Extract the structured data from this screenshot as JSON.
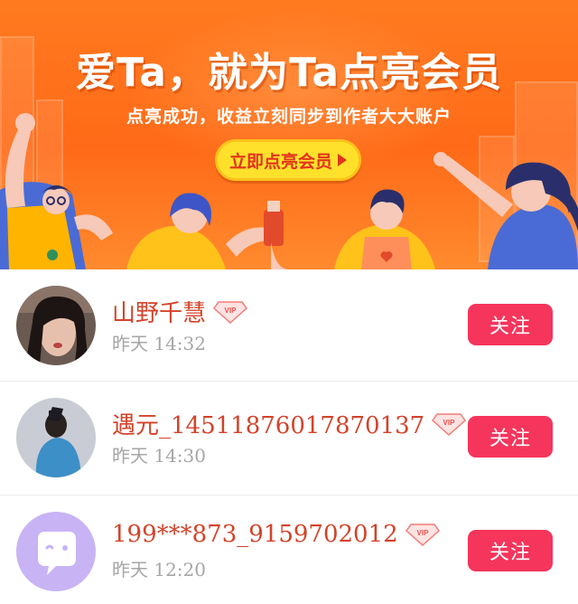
{
  "banner": {
    "title": "爱Ta，就为Ta点亮会员",
    "subtitle": "点亮成功，收益立刻同步到作者大大账户",
    "cta_label": "立即点亮会员"
  },
  "users": [
    {
      "name": "山野千慧",
      "vip_label": "VIP",
      "time": "昨天 14:32",
      "follow_label": "关注",
      "avatar": "photo-avatar"
    },
    {
      "name": "遇元_14511876017870137",
      "vip_label": "VIP",
      "time": "昨天 14:30",
      "follow_label": "关注",
      "avatar": "photo-avatar"
    },
    {
      "name": "199***873_9159702012",
      "vip_label": "VIP",
      "time": "昨天 12:20",
      "follow_label": "关注",
      "avatar": "default-avatar"
    }
  ],
  "colors": {
    "accent": "#f5355c",
    "name": "#d3432a",
    "banner": "#ff6a17",
    "cta": "#ffe12b"
  }
}
